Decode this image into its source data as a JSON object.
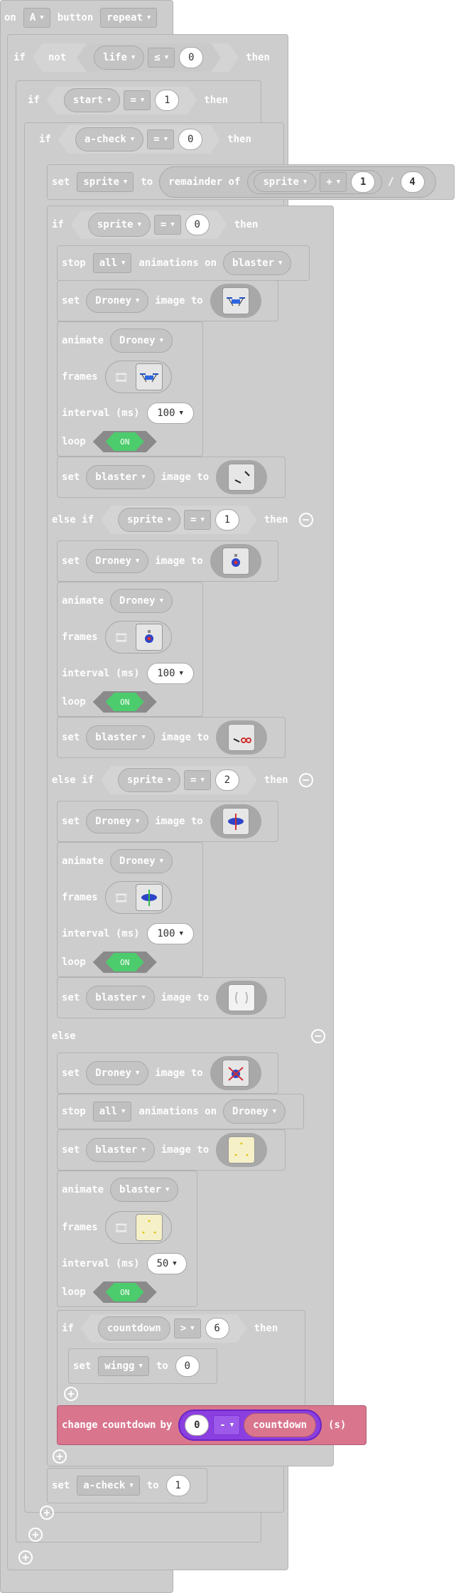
{
  "colors": {
    "block": "#cdcdcd",
    "text": "#ffffff",
    "toggle_on": "#4ccc6c",
    "change_block": "#d9768e",
    "math_block": "#8b3fe0"
  },
  "event": {
    "on": "on",
    "key": "A",
    "button": "button",
    "mode": "repeat"
  },
  "kw": {
    "if": "if",
    "not": "not",
    "then": "then",
    "set": "set",
    "to": "to",
    "remainder_of": "remainder of",
    "stop": "stop",
    "animations_on": "animations on",
    "image_to": "image to",
    "animate": "animate",
    "frames": "frames",
    "interval": "interval (ms)",
    "loop": "loop",
    "else_if": "else if",
    "else": "else",
    "change": "change",
    "by": "by",
    "seconds": "(s)",
    "on_toggle": "ON",
    "slash": "/"
  },
  "cond1": {
    "var": "life",
    "op": "≤",
    "value": "0"
  },
  "cond2": {
    "var": "start",
    "op": "=",
    "value": "1"
  },
  "cond3": {
    "var": "a-check",
    "op": "=",
    "value": "0"
  },
  "set_sprite": {
    "var": "sprite",
    "inner_var": "sprite",
    "op": "+",
    "add": "1",
    "divisor": "4"
  },
  "cond4": {
    "var": "sprite",
    "op": "=",
    "value": "0"
  },
  "stop1": {
    "which": "all",
    "target": "blaster"
  },
  "spriteA": {
    "droney": "Droney",
    "blaster": "blaster",
    "interval": "100"
  },
  "cond5": {
    "var": "sprite",
    "op": "=",
    "value": "1"
  },
  "spriteB": {
    "droney": "Droney",
    "blaster": "blaster",
    "interval": "100"
  },
  "cond6": {
    "var": "sprite",
    "op": "=",
    "value": "2"
  },
  "spriteC": {
    "droney": "Droney",
    "blaster": "blaster",
    "interval": "100"
  },
  "else_branch": {
    "droney": "Droney",
    "stop_which": "all",
    "stop_target": "Droney",
    "blaster": "blaster",
    "anim_target": "blaster",
    "interval": "50"
  },
  "cond7": {
    "var": "countdown",
    "op": ">",
    "value": "6"
  },
  "set_wingg": {
    "var": "wingg",
    "value": "0"
  },
  "change": {
    "var": "countdown",
    "amount": "0",
    "op": "-",
    "operand": "countdown"
  },
  "set_acheck": {
    "var": "a-check",
    "value": "1"
  },
  "icons": [
    "drone-icon",
    "film-icon",
    "blaster-icon",
    "plus-icon",
    "minus-icon",
    "chevron-down-icon"
  ]
}
